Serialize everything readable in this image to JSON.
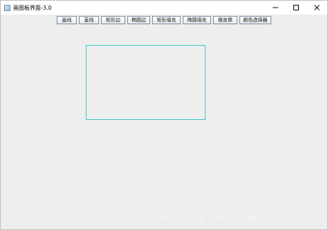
{
  "window": {
    "title": "画图板界面-3.0"
  },
  "toolbar": {
    "buttons": [
      {
        "label": "画线"
      },
      {
        "label": "直线"
      },
      {
        "label": "矩形边"
      },
      {
        "label": "椭圆边"
      },
      {
        "label": "矩形填充"
      },
      {
        "label": "椭圆填充"
      },
      {
        "label": "橡皮擦"
      },
      {
        "label": "颜色选择器"
      }
    ]
  },
  "canvas": {
    "shape": "rectangle-outline",
    "stroke_color": "#3cc6c8"
  },
  "watermark": {
    "text": "https://blog.csdn.net/weixin_44653383"
  },
  "icons": {
    "app": "java-app-icon",
    "minimize": "minimize-icon",
    "maximize": "maximize-icon",
    "close": "close-icon"
  }
}
